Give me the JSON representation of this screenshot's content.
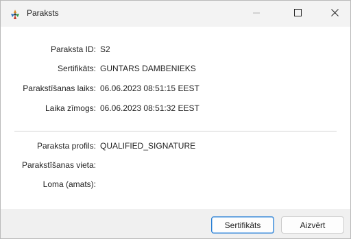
{
  "window": {
    "title": "Paraksts",
    "icon": "app-logo-icon",
    "controls": [
      "minimize-icon",
      "maximize-icon",
      "close-icon"
    ]
  },
  "details": {
    "signature_id_label": "Paraksta ID:",
    "signature_id_value": "S2",
    "certificate_label": "Sertifikāts:",
    "certificate_value": "GUNTARS DAMBENIEKS",
    "signing_time_label": "Parakstīšanas laiks:",
    "signing_time_value": "06.06.2023 08:51:15 EEST",
    "timestamp_label": "Laika zīmogs:",
    "timestamp_value": "06.06.2023 08:51:32 EEST",
    "profile_label": "Paraksta profils:",
    "profile_value": "QUALIFIED_SIGNATURE",
    "place_label": "Parakstīšanas vieta:",
    "place_value": "",
    "role_label": "Loma (amats):",
    "role_value": ""
  },
  "buttons": {
    "certificate": "Sertifikāts",
    "close": "Aizvērt"
  },
  "colors": {
    "titlebar_bg": "#f3f3f3",
    "footer_bg": "#f0f0f0",
    "focus_border": "#2a7fd4"
  }
}
